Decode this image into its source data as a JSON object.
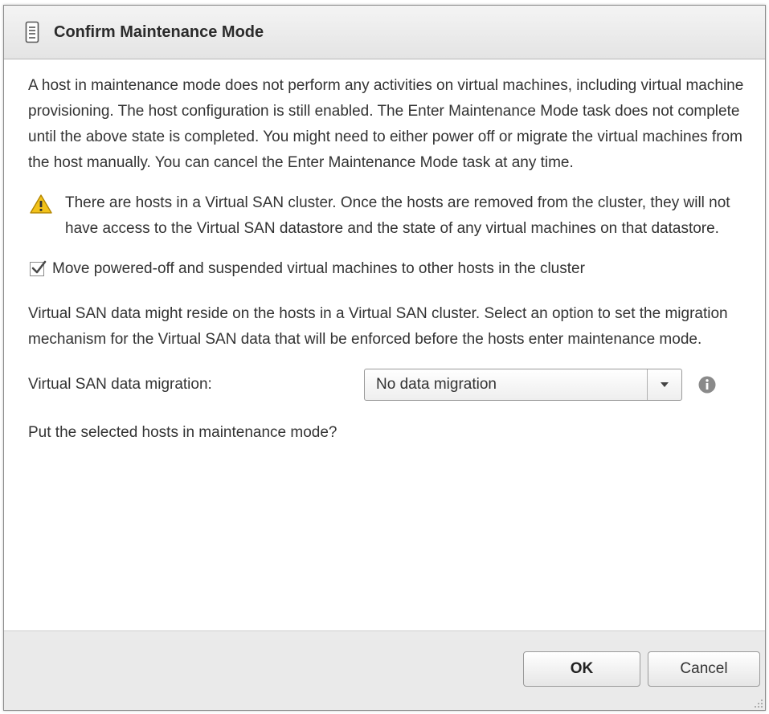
{
  "dialog": {
    "title": "Confirm Maintenance Mode",
    "title_icon": "host-server-icon"
  },
  "content": {
    "description": "A host in maintenance mode does not perform any activities on virtual machines, including virtual machine provisioning. The host configuration is still enabled. The Enter Maintenance Mode task does not complete until the above state is completed. You might need to either power off or migrate the virtual machines from the host manually. You can cancel the Enter Maintenance Mode task at any time.",
    "warning": {
      "icon": "warning-icon",
      "text": "There are hosts in a Virtual SAN cluster. Once the hosts are removed from the cluster, they will not have access to the Virtual SAN datastore and the state of any virtual machines on that datastore."
    },
    "move_vms": {
      "checked": true,
      "label": "Move powered-off and suspended virtual machines to other hosts in the cluster"
    },
    "vsan_info": "Virtual SAN data might reside on the hosts in a Virtual SAN cluster. Select an option to set the migration mechanism for the Virtual SAN data that will be enforced before the hosts enter maintenance mode.",
    "migration": {
      "label": "Virtual SAN data migration:",
      "selected": "No data migration",
      "info_icon": "info-icon"
    },
    "question": "Put the selected hosts in maintenance mode?"
  },
  "footer": {
    "ok_label": "OK",
    "cancel_label": "Cancel"
  },
  "colors": {
    "title_bar": "#e8e8e8",
    "footer": "#eaeaea",
    "warning": "#f2c21a",
    "info": "#8a8a8a"
  }
}
